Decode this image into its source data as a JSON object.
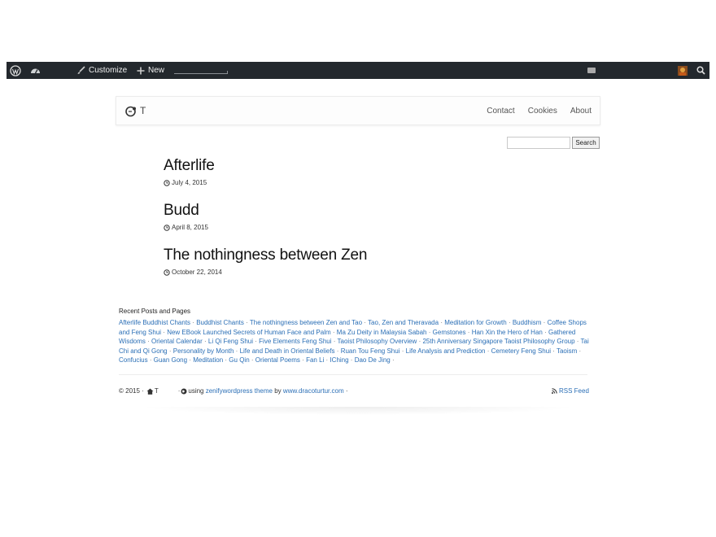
{
  "adminbar": {
    "customize_label": "Customize",
    "new_label": "New",
    "icons": [
      "wordpress-icon",
      "dashboard-icon",
      "brush-icon",
      "plus-icon",
      "comment-icon",
      "avatar-icon",
      "search-icon"
    ]
  },
  "site": {
    "title": "T",
    "nav": [
      "Contact",
      "Cookies",
      "About"
    ]
  },
  "search": {
    "button_label": "Search",
    "value": ""
  },
  "posts": [
    {
      "title": "Afterlife",
      "date": "July 4, 2015"
    },
    {
      "title": "Budd",
      "date": "April 8, 2015"
    },
    {
      "title": "The nothingness between Zen",
      "date": "October 22, 2014"
    }
  ],
  "recent": {
    "heading": "Recent Posts and Pages",
    "links": [
      "Afterlife Buddhist Chants",
      "Buddhist Chants",
      "The nothingness between Zen and Tao",
      "Tao, Zen and Theravada",
      "Meditation for Growth",
      "Buddhism",
      "Coffee Shops and Feng Shui",
      "New EBook Launched Secrets of Human Face and Palm",
      "Ma Zu Deity in Malaysia Sabah",
      "Gemstones",
      "Han Xin the Hero of Han",
      "Gathered Wisdoms",
      "Oriental Calendar",
      "Li Qi Feng Shui",
      "Five Elements Feng Shui",
      "Taoist Philosophy Overview",
      "25th Anniversary Singapore Taoist Philosophy Group",
      "Tai Chi and Qi Gong",
      "Personality by Month",
      "Life and Death in Oriental Beliefs",
      "Ruan Tou Feng Shui",
      "Life Analysis and Prediction",
      "Cemetery Feng Shui",
      "Taoism",
      "Confucius",
      "Guan Gong",
      "Meditation",
      "Gu Qin",
      "Oriental Poems",
      "Fan Li",
      "IChing",
      "Dao De Jing"
    ]
  },
  "footer": {
    "copyright": "© 2015 ·",
    "home_label": "T",
    "using_text": "using",
    "theme_link": "zenifywordpress theme",
    "by_text": "by",
    "author_link": "www.dracoturtur.com",
    "sep": "·",
    "rss_label": "RSS Feed"
  }
}
